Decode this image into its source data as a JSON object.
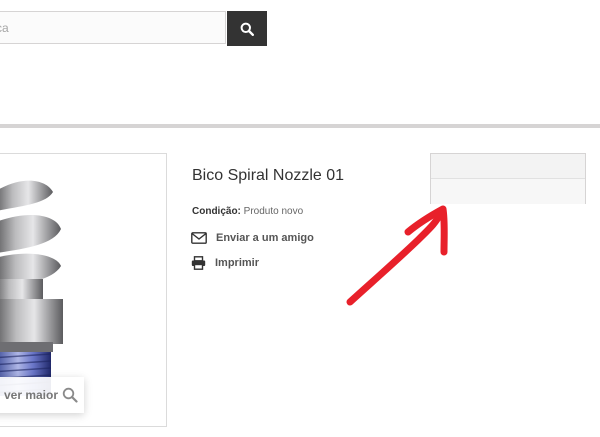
{
  "search": {
    "placeholder": "cca",
    "button_icon": "search-icon"
  },
  "product": {
    "title": "Bico Spiral Nozzle 01",
    "condition_label": "Condição:",
    "condition_value": "Produto novo",
    "send_to_friend": "Enviar a um amigo",
    "print": "Imprimir",
    "zoom_label": "ver maior"
  },
  "colors": {
    "search_button": "#333333",
    "annotation_arrow": "#e8202a",
    "divider": "#d6d4d4"
  }
}
